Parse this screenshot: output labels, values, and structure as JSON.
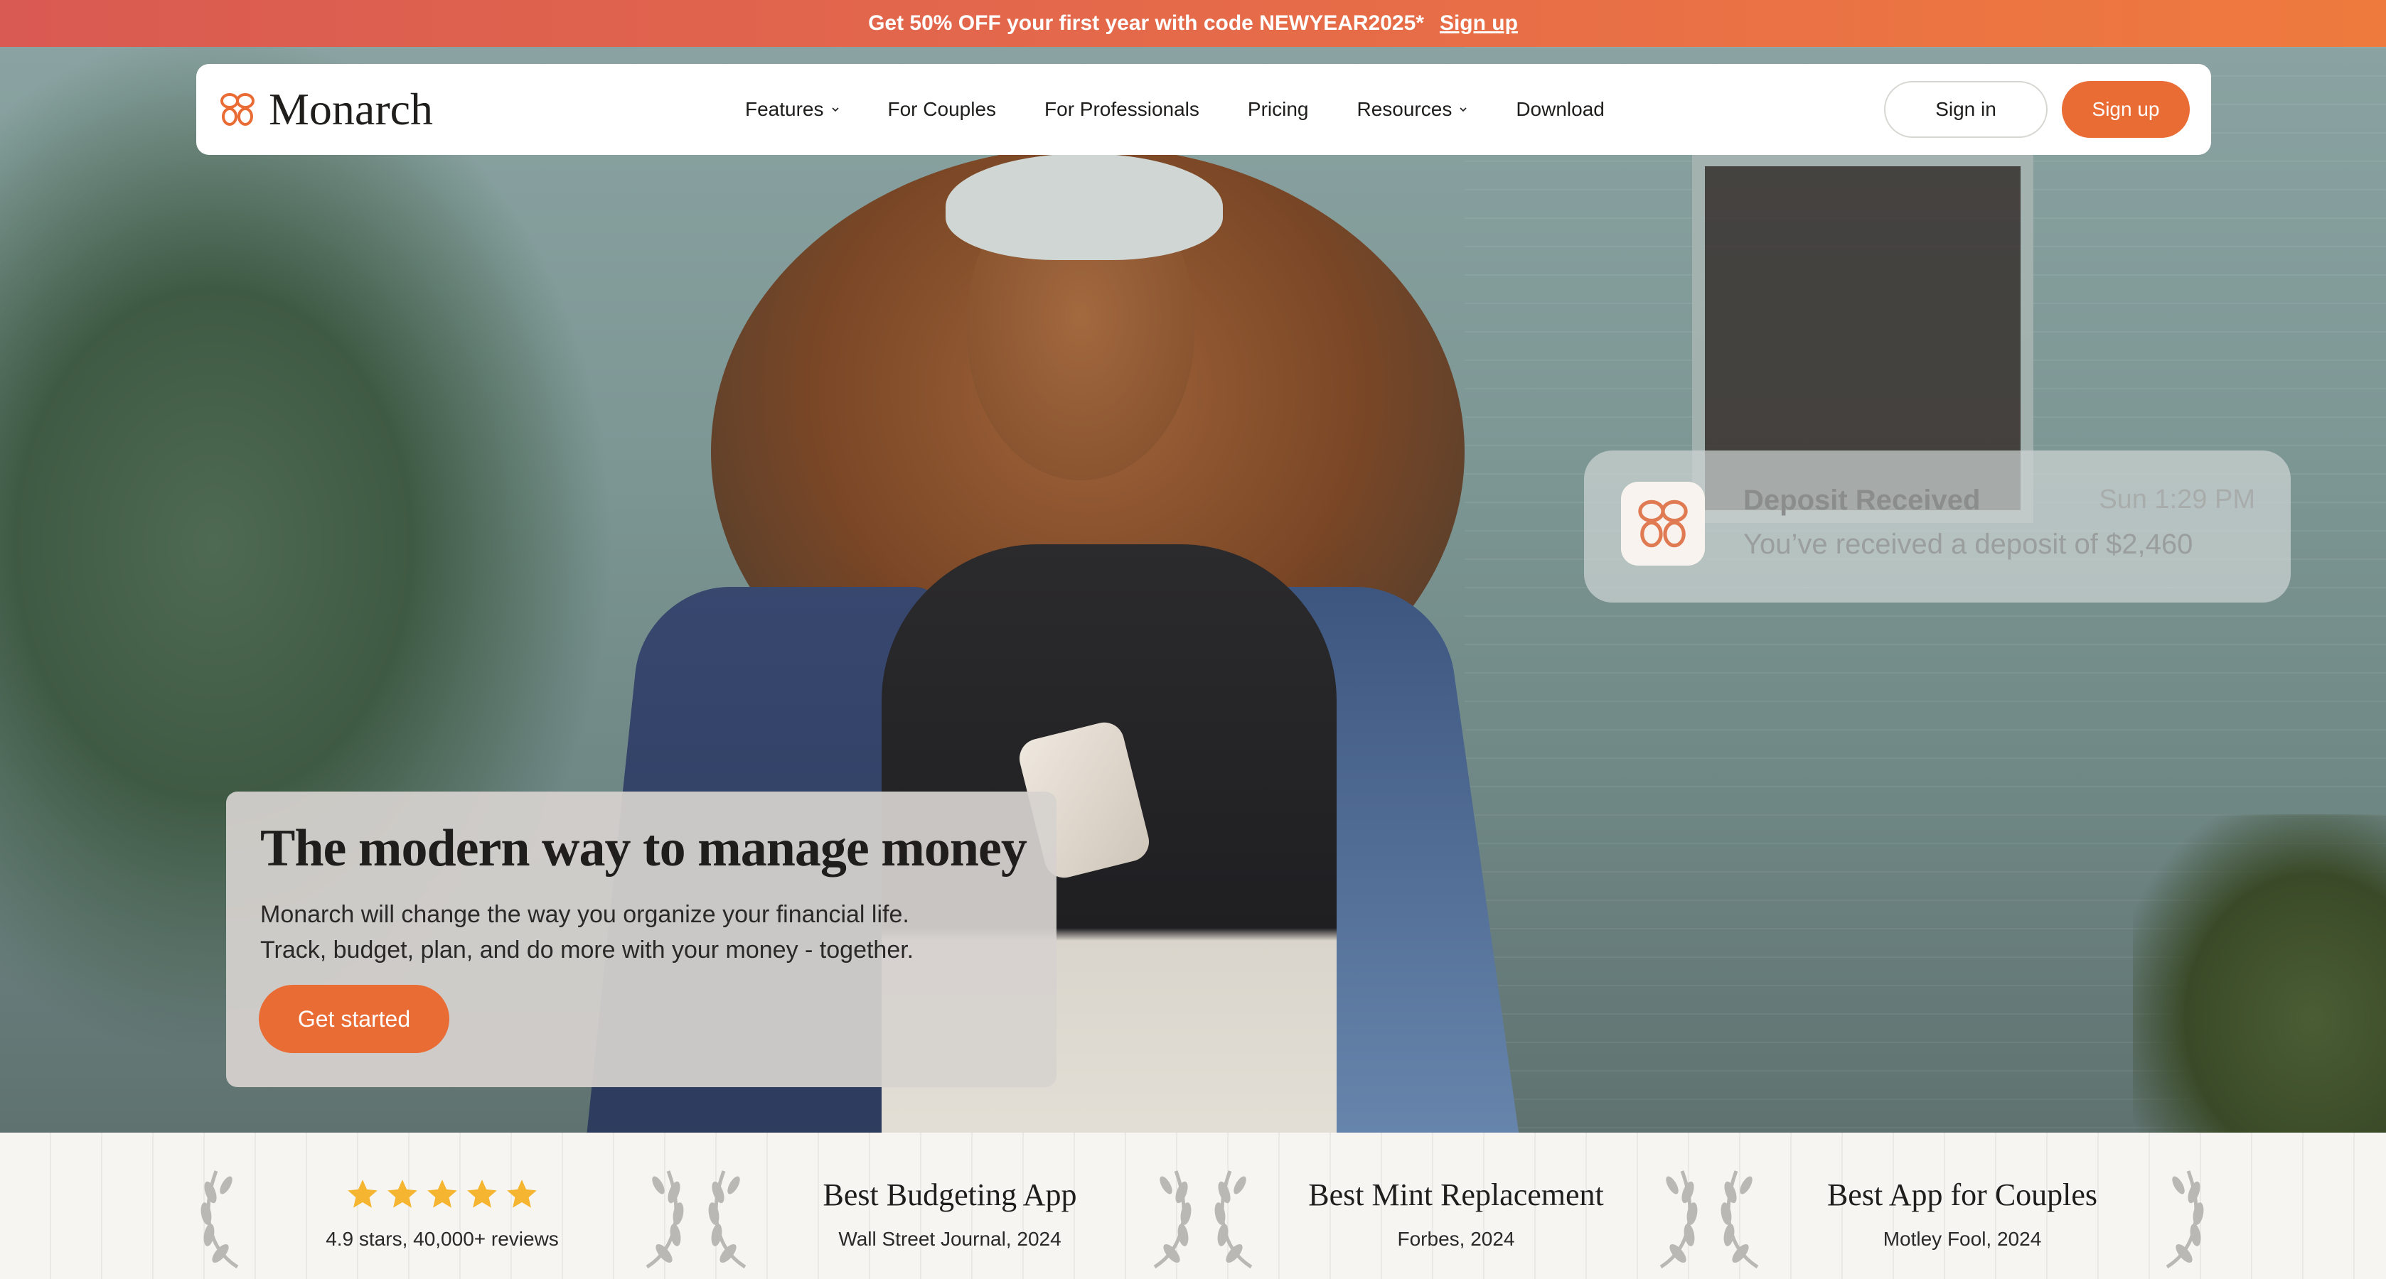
{
  "promo": {
    "text": "Get 50% OFF your first year with code NEWYEAR2025*",
    "link": "Sign up"
  },
  "brand": {
    "name": "Monarch",
    "accent": "#ea6c35"
  },
  "nav": {
    "links": [
      {
        "label": "Features",
        "dropdown": true
      },
      {
        "label": "For Couples",
        "dropdown": false
      },
      {
        "label": "For Professionals",
        "dropdown": false
      },
      {
        "label": "Pricing",
        "dropdown": false
      },
      {
        "label": "Resources",
        "dropdown": true
      },
      {
        "label": "Download",
        "dropdown": false
      }
    ],
    "signin": "Sign in",
    "signup": "Sign up"
  },
  "notification": {
    "title": "Deposit Received",
    "time": "Sun 1:29 PM",
    "body": "You’ve received a deposit of $2,460",
    "icon": "monarch-butterfly-icon"
  },
  "hero": {
    "title": "The modern way to manage money",
    "subtitle_line1": "Monarch will change the way you organize your financial life.",
    "subtitle_line2": "Track, budget, plan, and do more with your money - together.",
    "cta": "Get started"
  },
  "awards": [
    {
      "rating_stars": 5,
      "source": "4.9 stars, 40,000+ reviews"
    },
    {
      "title": "Best Budgeting App",
      "source": "Wall Street Journal, 2024"
    },
    {
      "title": "Best Mint Replacement",
      "source": "Forbes, 2024"
    },
    {
      "title": "Best App for Couples",
      "source": "Motley Fool, 2024"
    }
  ],
  "colors": {
    "star": "#f5b530",
    "laurel": "#b9b8b4",
    "signup_button": "#ea6c35"
  }
}
